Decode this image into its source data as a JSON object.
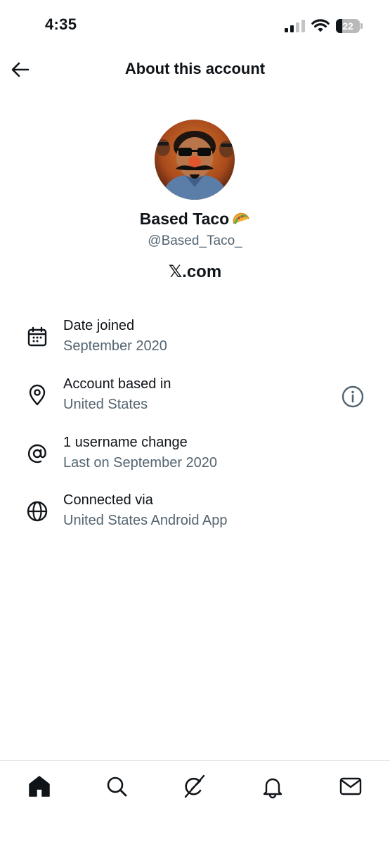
{
  "status_bar": {
    "time": "4:35",
    "battery_level": "22",
    "signal_bars_active": 2,
    "signal_bars_total": 4
  },
  "header": {
    "title": "About this account",
    "back_icon": "arrow-left-icon"
  },
  "profile": {
    "display_name": "Based Taco",
    "name_emoji": "taco",
    "handle": "@Based_Taco_",
    "site": "𝕏.com"
  },
  "info": [
    {
      "icon": "calendar-icon",
      "title": "Date joined",
      "subtitle": "September 2020"
    },
    {
      "icon": "location-pin-icon",
      "title": "Account based in",
      "subtitle": "United States",
      "action_icon": "info-circle-icon"
    },
    {
      "icon": "at-sign-icon",
      "title": "1 username change",
      "subtitle": "Last on September 2020"
    },
    {
      "icon": "globe-icon",
      "title": "Connected via",
      "subtitle": "United States Android App"
    }
  ],
  "tab_bar": {
    "tabs": [
      "home-icon",
      "search-icon",
      "grok-icon",
      "notifications-bell-icon",
      "messages-envelope-icon"
    ],
    "active": "home-icon"
  },
  "colors": {
    "text_primary": "#0f1419",
    "text_secondary": "#536471",
    "divider": "#dfe3e6",
    "background": "#ffffff"
  }
}
